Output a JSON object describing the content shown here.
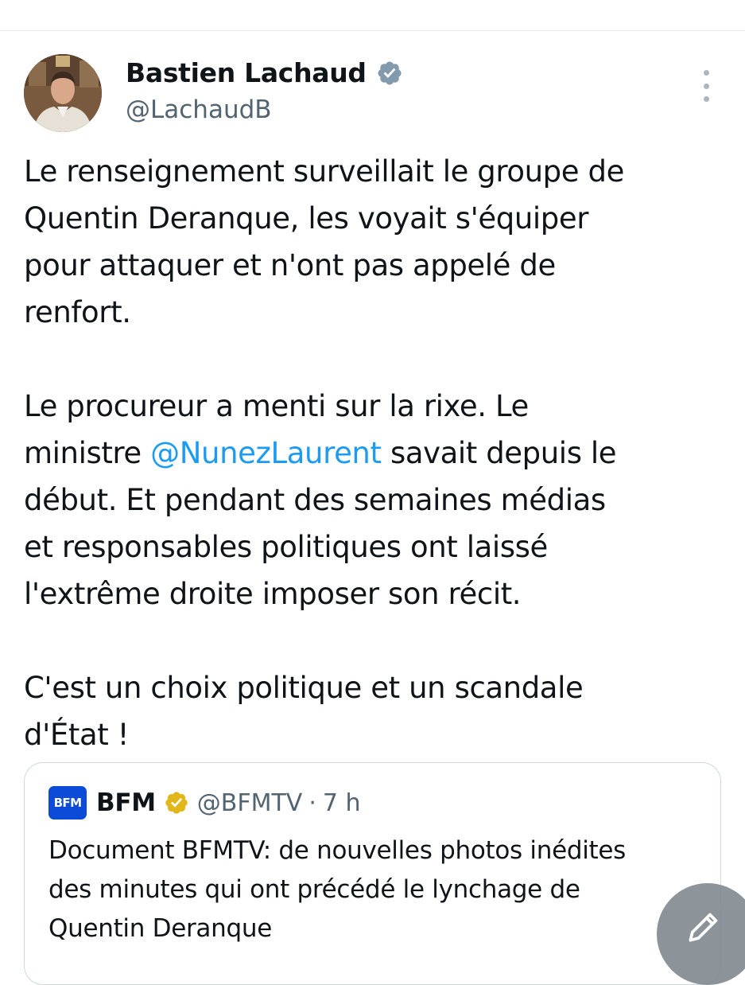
{
  "tweet": {
    "author": {
      "display_name": "Bastien Lachaud",
      "handle": "@LachaudB",
      "verified": true,
      "badge_color": "#829aab"
    },
    "body": {
      "paragraph1": [
        "Le renseignement surveillait le groupe de",
        "Quentin Deranque, les voyait s'équiper",
        "pour attaquer et n'ont pas appelé de",
        "renfort."
      ],
      "paragraph2": {
        "line1": "Le procureur a menti sur la rixe. Le",
        "line2_before": "ministre ",
        "line2_mention": "@NunezLaurent",
        "line2_after": " savait depuis le",
        "line3": "début. Et pendant des semaines médias",
        "line4": "et responsables politiques ont laissé",
        "line5": "l'extrême droite imposer son récit."
      },
      "paragraph3": [
        "C'est un choix politique et un scandale",
        "d'État !"
      ]
    },
    "mention_color": "#1d9bf0"
  },
  "quoted_tweet": {
    "logo_text": "BFM",
    "name": "BFM",
    "handle": "@BFMTV",
    "separator": "·",
    "time": "7 h",
    "badge_color": "#e2b719",
    "logo_color": "#0b4bd8",
    "text": [
      "Document BFMTV: de nouvelles photos inédites",
      "des minutes qui ont précédé le lynchage de",
      "Quentin Deranque"
    ]
  },
  "icons": {
    "more": "more-vertical-icon",
    "verified": "verified-badge-icon",
    "gold_verified": "gold-verified-badge-icon",
    "compose": "compose-pencil-icon"
  }
}
